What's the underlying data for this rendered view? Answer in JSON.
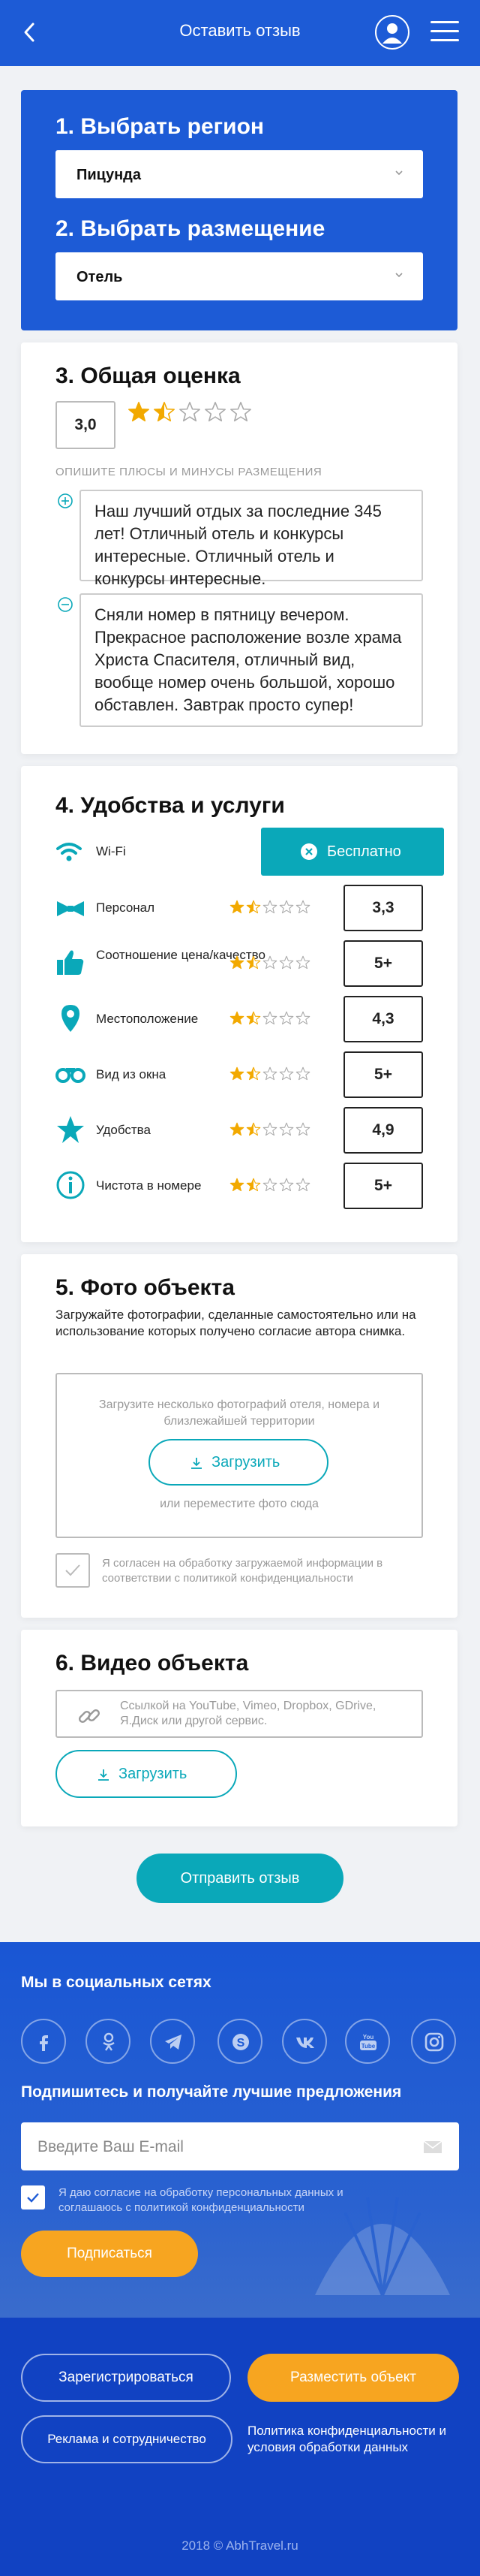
{
  "header": {
    "title": "Оставить отзыв"
  },
  "region": {
    "heading": "1. Выбрать регион",
    "value": "Пицунда",
    "placement_heading": "2. Выбрать размещение",
    "placement_value": "Отель"
  },
  "overall": {
    "heading": "3. Общая оценка",
    "score": "3,0",
    "rating": 1.5,
    "describe_label": "ОПИШИТЕ ПЛЮСЫ И МИНУСЫ РАЗМЕЩЕНИЯ",
    "plus_text": "Наш лучший отдых за последние 345 лет! Отличный отель и конкурсы интересные. Отличный отель и конкурсы интересные.",
    "minus_text": "Сняли номер в пятницу вечером. Прекрасное расположение возле храма Христа Спасителя, отличный вид, вообще номер очень большой, хорошо обставлен. Завтрак просто супер!"
  },
  "amenities": {
    "heading": "4. Удобства и услуги",
    "wifi_label": "Wi-Fi",
    "free_label": "Бесплатно",
    "items": [
      {
        "label": "Персонал",
        "rating": 1.5,
        "value": "3,3",
        "icon": "bowtie-icon"
      },
      {
        "label": "Соотношение цена/качество",
        "rating": 1.5,
        "value": "5+",
        "icon": "thumbs-up-icon"
      },
      {
        "label": "Местоположение",
        "rating": 1.5,
        "value": "4,3",
        "icon": "location-pin-icon"
      },
      {
        "label": "Вид из окна",
        "rating": 1.5,
        "value": "5+",
        "icon": "binoculars-icon"
      },
      {
        "label": "Удобства",
        "rating": 1.5,
        "value": "4,9",
        "icon": "star-icon"
      },
      {
        "label": "Чистота в номере",
        "rating": 1.5,
        "value": "5+",
        "icon": "info-icon"
      }
    ]
  },
  "photo": {
    "heading": "5. Фото объекта",
    "description": "Загружайте фотографии, сделанные самостоятельно или на использование которых получено согласие автора снимка.",
    "drop_hint": "Загрузите несколько фотографий отеля, номера и близлежайшей территории",
    "upload_label": "Загрузить",
    "drag_hint": "или переместите фото сюда",
    "consent": "Я согласен на обработку загружаемой информации в соответствии с политикой конфиденциальности"
  },
  "video": {
    "heading": "6. Видео объекта",
    "link_placeholder": "Ссылкой на YouTube, Vimeo, Dropbox, GDrive, Я.Диск или другой сервис.",
    "upload_label": "Загрузить"
  },
  "submit_label": "Отправить отзыв",
  "footer": {
    "social_heading": "Мы в социальных сетях",
    "social": [
      "facebook-icon",
      "odnoklassniki-icon",
      "telegram-icon",
      "skype-icon",
      "vk-icon",
      "youtube-icon",
      "instagram-icon"
    ],
    "subscribe_heading": "Подпишитесь и получайте лучшие предложения",
    "email_placeholder": "Введите Ваш E-mail",
    "consent": "Я даю согласие на обработку персональных данных и соглашаюсь с политикой конфиденциальности",
    "subscribe_label": "Подписаться",
    "register_label": "Зарегистрироваться",
    "place_object_label": "Разместить объект",
    "ads_label": "Реклама и сотрудничество",
    "privacy_label": "Политика конфиденциальности и условия обработки данных",
    "copyright": "2018 © AbhTravel.ru"
  },
  "colors": {
    "primary": "#1d5bd6",
    "accent": "#0aa8b9",
    "orange": "#f7a520",
    "star": "#f2a900"
  }
}
